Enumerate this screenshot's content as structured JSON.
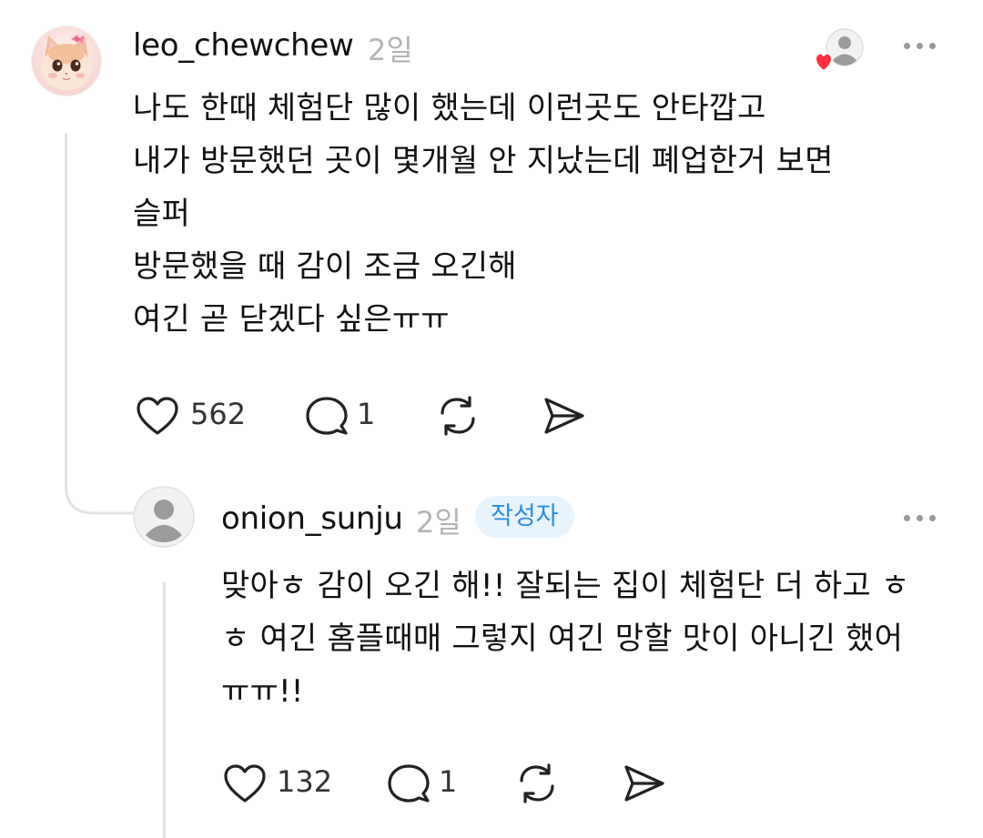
{
  "comment": {
    "username": "leo_chewchew",
    "time": "2일",
    "lines": [
      "나도 한때 체험단 많이 했는데 이런곳도 안타깝고",
      "내가 방문했던 곳이 몇개월 안 지났는데 폐업한거 보면",
      "슬퍼",
      "방문했을 때 감이 조금 오긴해",
      "여긴 곧 닫겠다 싶은ㅠㅠ"
    ],
    "likes": "562",
    "replies": "1",
    "icons": [
      "cat-avatar",
      "liked-by-author-icon",
      "more-icon",
      "heart-icon",
      "comment-icon",
      "repost-icon",
      "share-icon"
    ]
  },
  "reply": {
    "username": "onion_sunju",
    "time": "2일",
    "badge": "작성자",
    "lines": [
      "맞아ㅎ 감이 오긴 해!! 잘되는 집이 체험단 더 하고 ㅎ",
      "ㅎ 여긴 홈플때매 그렇지 여긴 망할 맛이 아니긴 했어",
      "ㅠㅠ!!"
    ],
    "likes": "132",
    "replies": "1",
    "icons": [
      "default-avatar",
      "more-icon",
      "heart-icon",
      "comment-icon",
      "repost-icon",
      "share-icon"
    ]
  },
  "colors": {
    "badge_bg": "#e7f3fd",
    "badge_text": "#2b8ee0",
    "muted": "#b4b4b4",
    "heart_red": "#ff3040"
  }
}
